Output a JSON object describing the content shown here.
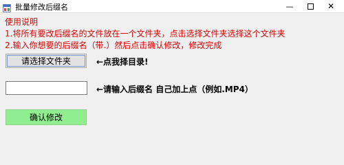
{
  "window": {
    "title": "批量修改后缀名",
    "minimize": "—",
    "close": "✕"
  },
  "instructions": {
    "heading": "使用说明",
    "line1": "1.将所有要改后缀名的文件放在一个文件夹，点击选择文件夹选择这个文件夹",
    "line2": "2.输入你想要的后缀名（带.）然后点击确认修改，修改完成"
  },
  "form": {
    "select_folder_label": "请选择文件夹",
    "select_hint": "←点我择目录!",
    "suffix_value": "",
    "suffix_hint": "←请输入后缀名 自己加上点（例如.MP4）",
    "confirm_label": "确认修改"
  },
  "colors": {
    "instruction_text": "#e00000",
    "confirm_button": "#90ee90",
    "button_face": "#e1e1e1"
  }
}
